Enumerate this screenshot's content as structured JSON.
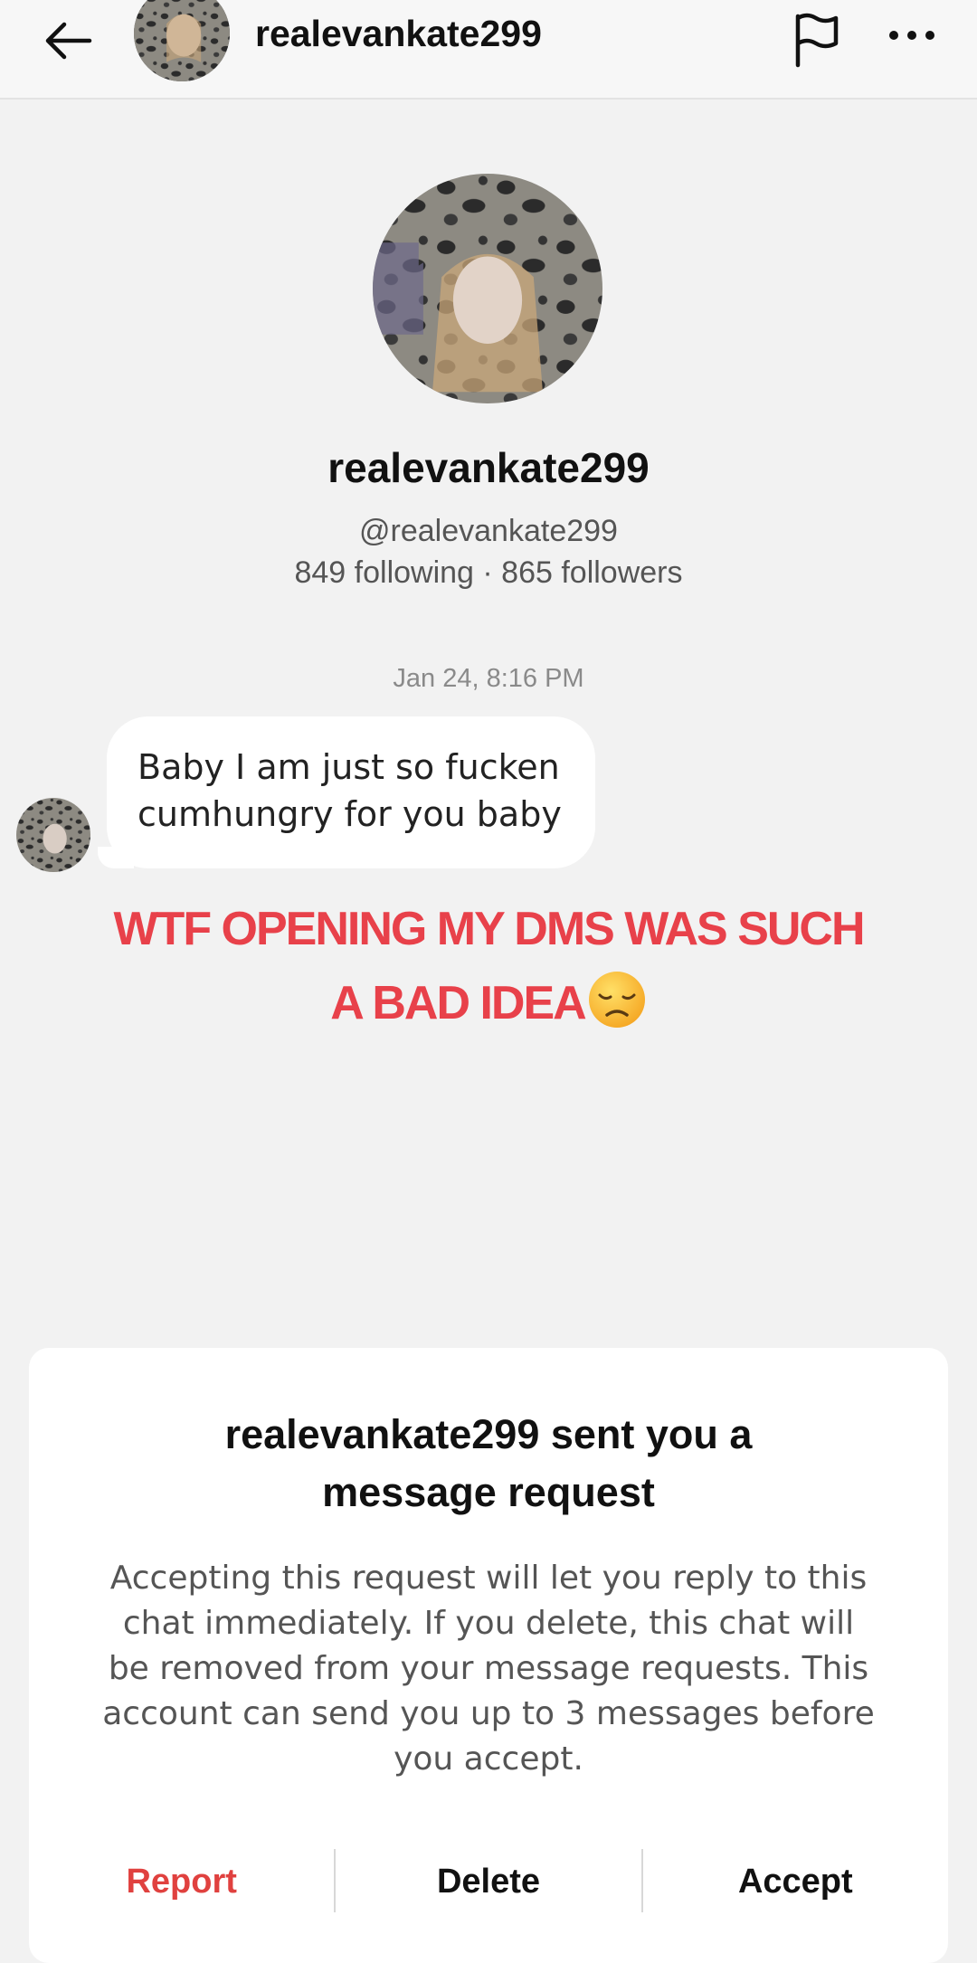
{
  "header": {
    "username": "realevankate299",
    "back_icon": "arrow-left-icon",
    "flag_icon": "flag-icon",
    "more_icon": "more-horizontal-icon"
  },
  "profile": {
    "display_name": "realevankate299",
    "handle": "@realevankate299",
    "stats": "849 following · 865 followers"
  },
  "conversation": {
    "timestamp": "Jan 24, 8:16 PM",
    "message_line1": "Baby I am just so fucken",
    "message_line2": "cumhungry for you baby"
  },
  "overlay": {
    "line1": "WTF OPENING MY DMS WAS SUCH",
    "line2": "A BAD IDEA",
    "emoji": "disappointed-face-icon",
    "color": "#e8414a"
  },
  "request_panel": {
    "title_line1": "realevankate299 sent you a",
    "title_line2": "message request",
    "body_lines": [
      "Accepting this request will let you reply to this",
      "chat immediately. If you delete, this chat will",
      "be removed from your message requests. This",
      "account can send you up to 3 messages before",
      "you accept."
    ],
    "report_label": "Report",
    "delete_label": "Delete",
    "accept_label": "Accept",
    "report_color": "#e0413f"
  }
}
